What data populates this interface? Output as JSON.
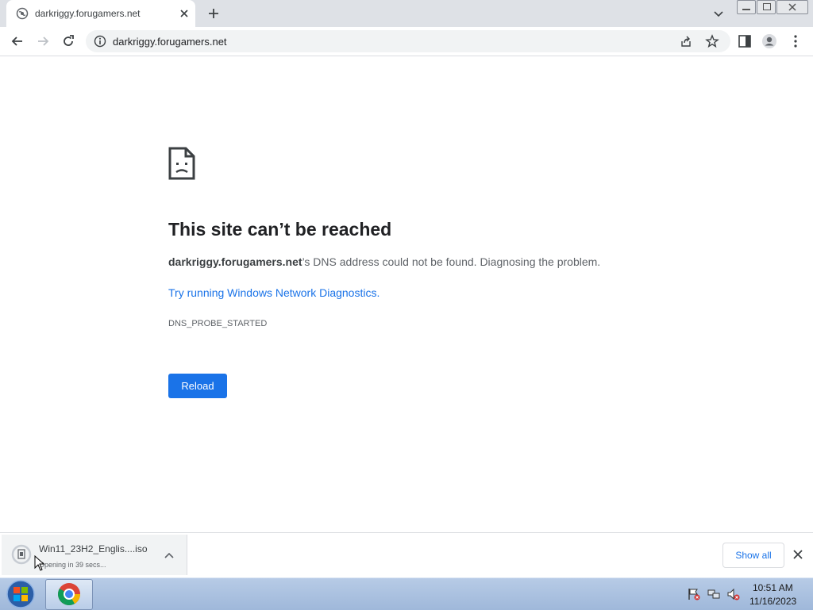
{
  "browser": {
    "tab": {
      "title": "darkriggy.forugamers.net"
    },
    "address": {
      "url": "darkriggy.forugamers.net"
    }
  },
  "error_page": {
    "title": "This site can’t be reached",
    "host": "darkriggy.forugamers.net",
    "message_suffix": "’s DNS address could not be found. Diagnosing the problem.",
    "diagnostics_link": "Try running Windows Network Diagnostics.",
    "error_code": "DNS_PROBE_STARTED",
    "reload_label": "Reload"
  },
  "download_bar": {
    "file_name": "Win11_23H2_Englis....iso",
    "status": "Opening in 39 secs...",
    "show_all_label": "Show all"
  },
  "taskbar": {
    "time": "10:51 AM",
    "date": "11/16/2023"
  },
  "colors": {
    "accent": "#1a73e8",
    "tabstrip": "#dee1e6",
    "taskbar": "#a8c0e0"
  }
}
